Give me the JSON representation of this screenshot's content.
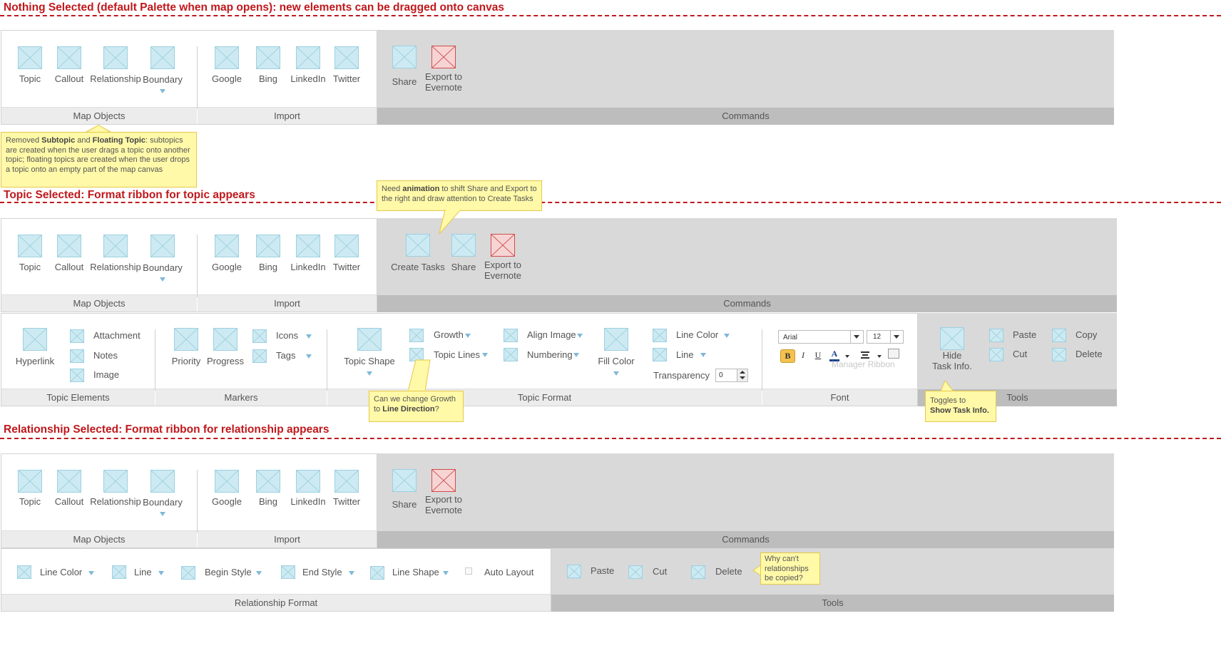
{
  "headings": {
    "s1": "Nothing Selected (default Palette when map opens): new elements can be dragged onto canvas",
    "s2": "Topic Selected: Format ribbon for topic appears",
    "s3": "Relationship Selected: Format ribbon for relationship appears"
  },
  "map_objects": {
    "topic": "Topic",
    "callout": "Callout",
    "relationship": "Relationship",
    "boundary": "Boundary",
    "group": "Map Objects"
  },
  "import": {
    "google": "Google",
    "bing": "Bing",
    "linkedin": "LinkedIn",
    "twitter": "Twitter",
    "group": "Import"
  },
  "commands": {
    "create_tasks": "Create Tasks",
    "share": "Share",
    "export_line1": "Export to",
    "export_line2": "Evernote",
    "group": "Commands"
  },
  "topic_ribbon": {
    "hyperlink": "Hyperlink",
    "attachment": "Attachment",
    "notes": "Notes",
    "image": "Image",
    "topic_elements": "Topic Elements",
    "priority": "Priority",
    "progress": "Progress",
    "icons": "Icons",
    "tags": "Tags",
    "markers": "Markers",
    "topic_shape": "Topic Shape",
    "growth": "Growth",
    "topic_lines": "Topic Lines",
    "align_image": "Align Image",
    "numbering": "Numbering",
    "fill_color": "Fill Color",
    "line_color": "Line Color",
    "line": "Line",
    "transparency": "Transparency",
    "transparency_value": "0",
    "topic_format": "Topic Format",
    "font_name": "Arial",
    "font_size": "12",
    "bold": "B",
    "italic": "I",
    "underline": "U",
    "color_a": "A",
    "manager_ribbon": "Manager Ribbon",
    "font": "Font",
    "hide_task_line1": "Hide",
    "hide_task_line2": "Task Info.",
    "paste": "Paste",
    "copy": "Copy",
    "cut": "Cut",
    "delete": "Delete",
    "tools": "Tools"
  },
  "relationship_ribbon": {
    "line_color": "Line Color",
    "line": "Line",
    "begin_style": "Begin Style",
    "end_style": "End Style",
    "line_shape": "Line Shape",
    "auto_layout": "Auto Layout",
    "group": "Relationship Format",
    "paste": "Paste",
    "cut": "Cut",
    "delete": "Delete",
    "tools": "Tools"
  },
  "notes": {
    "n1": {
      "p1": "Removed ",
      "b1": "Subtopic",
      "p2": " and ",
      "b2": "Floating Topic",
      "p3": ": subtopics are created when the user drags a topic onto another topic; floating topics are created when the user drops a topic onto an empty part of the map canvas"
    },
    "n2": {
      "p1": "Need ",
      "b1": "animation",
      "p2": " to shift Share and Export to the right and draw attention to Create Tasks"
    },
    "n3": {
      "p1": "Can we change Growth to ",
      "b1": "Line Direction",
      "p2": "?"
    },
    "n4": {
      "p1": "Toggles to",
      "b1": "Show Task Info."
    },
    "n5": {
      "p1": "Why can't relationships be copied?"
    }
  },
  "icons": {
    "placeholder": "image-placeholder-icon",
    "dropdown": "dropdown-triangle-icon"
  },
  "colors": {
    "heading": "#c0181c",
    "icon_fill": "#cdeaf2",
    "icon_border": "#9dd0e0",
    "export_icon_fill": "#f6d4d4",
    "note_fill": "#fff9a8",
    "panel_grey": "#d9d9d9"
  }
}
